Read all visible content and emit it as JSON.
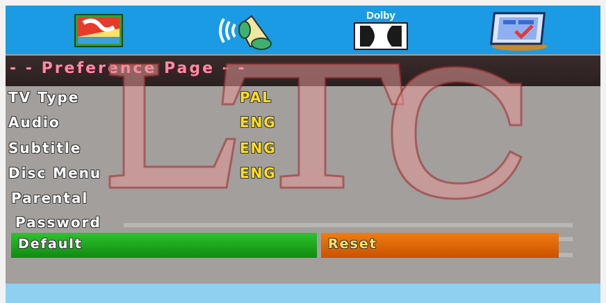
{
  "top_tabs": [
    {
      "name": "general-setup",
      "icon": "painting-icon"
    },
    {
      "name": "audio-setup",
      "icon": "speaker-icon"
    },
    {
      "name": "dolby-setup",
      "icon": "dolby-logo-icon",
      "label": "Dolby"
    },
    {
      "name": "preference-setup",
      "icon": "monitor-check-icon"
    }
  ],
  "page_title": "- -  Preference  Page  - -",
  "watermark_text": "LTC",
  "settings": [
    {
      "label": "TV  Type",
      "value": "PAL"
    },
    {
      "label": "Audio",
      "value": "ENG"
    },
    {
      "label": "Subtitle",
      "value": "ENG"
    },
    {
      "label": "Disc  Menu",
      "value": "ENG"
    },
    {
      "label": "Parental",
      "value": ""
    },
    {
      "label": "Password",
      "value": ""
    }
  ],
  "buttons": {
    "default_label": "Default",
    "reset_label": "Reset"
  },
  "colors": {
    "top_bar": "#1a9be3",
    "default_button": "#1fa81f",
    "reset_button": "#e56a08",
    "value_text": "#ffdd22",
    "title_text": "#ff8aa6"
  }
}
